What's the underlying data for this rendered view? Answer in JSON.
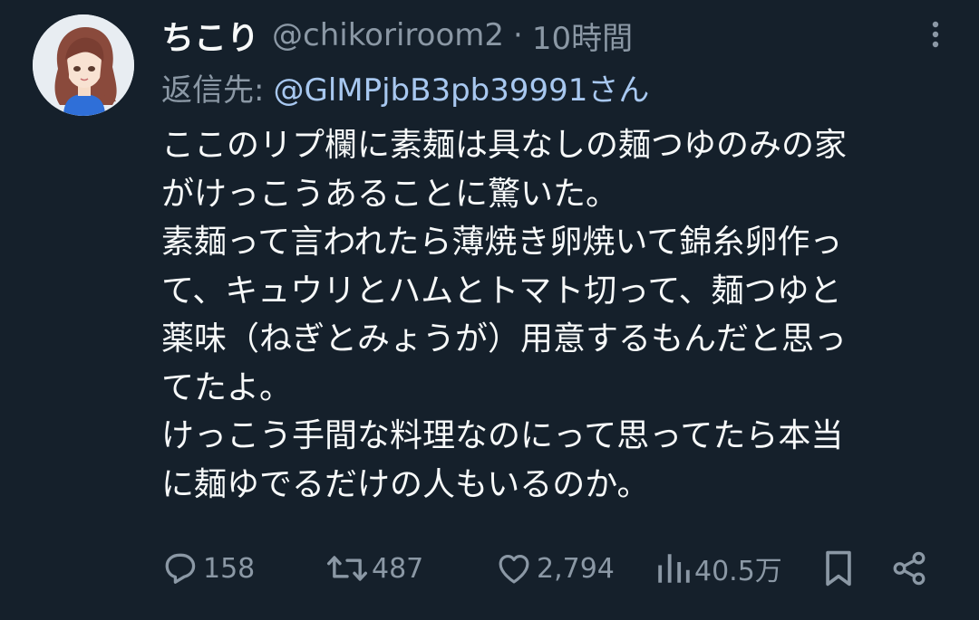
{
  "author": {
    "display_name": "ちこり",
    "handle": "@chikoriroom2",
    "separator": "·",
    "time": "10時間"
  },
  "reply": {
    "label": "返信先:",
    "target": "@GlMPjbB3pb39991さん"
  },
  "body_lines": [
    "ここのリプ欄に素麺は具なしの麺つゆのみの家",
    "がけっこうあることに驚いた。",
    "素麺って言われたら薄焼き卵焼いて錦糸卵作っ",
    "て、キュウリとハムとトマト切って、麺つゆと",
    "薬味（ねぎとみょうが）用意するもんだと思っ",
    "てたよ。",
    "けっこう手間な料理なのにって思ってたら本当",
    "に麺ゆでるだけの人もいるのか。"
  ],
  "actions": {
    "replies": "158",
    "reposts": "487",
    "likes": "2,794",
    "views": "40.5万"
  },
  "icons": {
    "more": "more-vertical-icon",
    "reply": "reply-icon",
    "repost": "repost-icon",
    "like": "heart-icon",
    "views": "views-chart-icon",
    "bookmark": "bookmark-icon",
    "share": "share-icon"
  },
  "colors": {
    "background": "#15202b",
    "text": "#f7f9f9",
    "muted": "#8b98a5",
    "link": "#a8c8f0"
  }
}
